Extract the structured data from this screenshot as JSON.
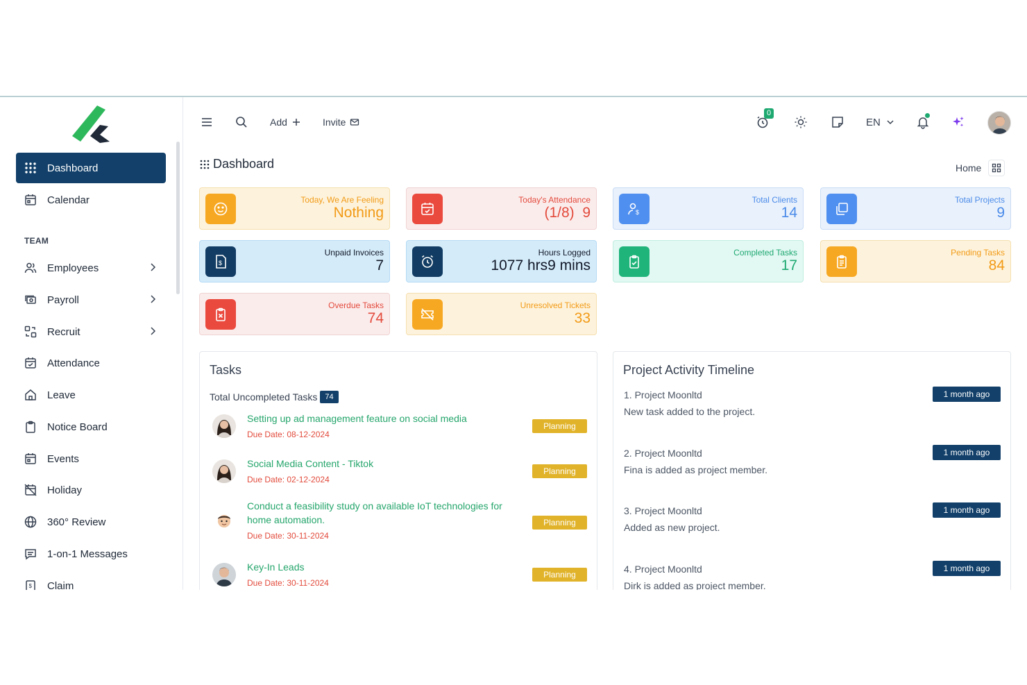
{
  "sidebar": {
    "items": [
      {
        "label": "Dashboard"
      },
      {
        "label": "Calendar"
      },
      {
        "label": "Employees"
      },
      {
        "label": "Payroll"
      },
      {
        "label": "Recruit"
      },
      {
        "label": "Attendance"
      },
      {
        "label": "Leave"
      },
      {
        "label": "Notice Board"
      },
      {
        "label": "Events"
      },
      {
        "label": "Holiday"
      },
      {
        "label": "360° Review"
      },
      {
        "label": "1-on-1 Messages"
      },
      {
        "label": "Claim"
      }
    ],
    "section_team": "TEAM"
  },
  "topbar": {
    "add_label": "Add",
    "invite_label": "Invite",
    "timer_count": "0",
    "language": "EN"
  },
  "page": {
    "title": "Dashboard",
    "breadcrumb": "Home"
  },
  "cards": {
    "feeling": {
      "label": "Today, We Are Feeling",
      "value": "Nothing"
    },
    "attendance": {
      "label": "Today's Attendance",
      "value": "(1/8)  9"
    },
    "clients": {
      "label": "Total Clients",
      "value": "14"
    },
    "projects": {
      "label": "Total Projects",
      "value": "9"
    },
    "invoices": {
      "label": "Unpaid Invoices",
      "value": "7"
    },
    "hours": {
      "label": "Hours Logged",
      "value": "1077 hrs9 mins"
    },
    "completed": {
      "label": "Completed Tasks",
      "value": "17"
    },
    "pending": {
      "label": "Pending Tasks",
      "value": "84"
    },
    "overdue": {
      "label": "Overdue Tasks",
      "value": "74"
    },
    "tickets": {
      "label": "Unresolved Tickets",
      "value": "33"
    }
  },
  "colors": {
    "primary": "#12406a",
    "success": "#1ea971",
    "warning": "#e1b32a",
    "danger": "#e24a3b"
  },
  "tasks": {
    "title": "Tasks",
    "subhead": "Total Uncompleted Tasks",
    "count": "74",
    "items": [
      {
        "title": "Setting up ad management feature on social media",
        "due": "Due Date: 08-12-2024",
        "status": "Planning"
      },
      {
        "title": "Social Media Content - Tiktok",
        "due": "Due Date: 02-12-2024",
        "status": "Planning"
      },
      {
        "title": "Conduct a feasibility study on available IoT technologies for home automation.",
        "due": "Due Date: 30-11-2024",
        "status": "Planning"
      },
      {
        "title": "Key-In Leads",
        "due": "Due Date: 30-11-2024",
        "status": "Planning"
      }
    ]
  },
  "timeline": {
    "title": "Project Activity Timeline",
    "items": [
      {
        "title": "1. Project Moonltd",
        "desc": "New task added to the project.",
        "time": "1 month ago"
      },
      {
        "title": "2. Project Moonltd",
        "desc": "Fina is added as project member.",
        "time": "1 month ago"
      },
      {
        "title": "3. Project Moonltd",
        "desc": "Added as new project.",
        "time": "1 month ago"
      },
      {
        "title": "4. Project Moonltd",
        "desc": "Dirk is added as project member.",
        "time": "1 month ago"
      }
    ]
  }
}
